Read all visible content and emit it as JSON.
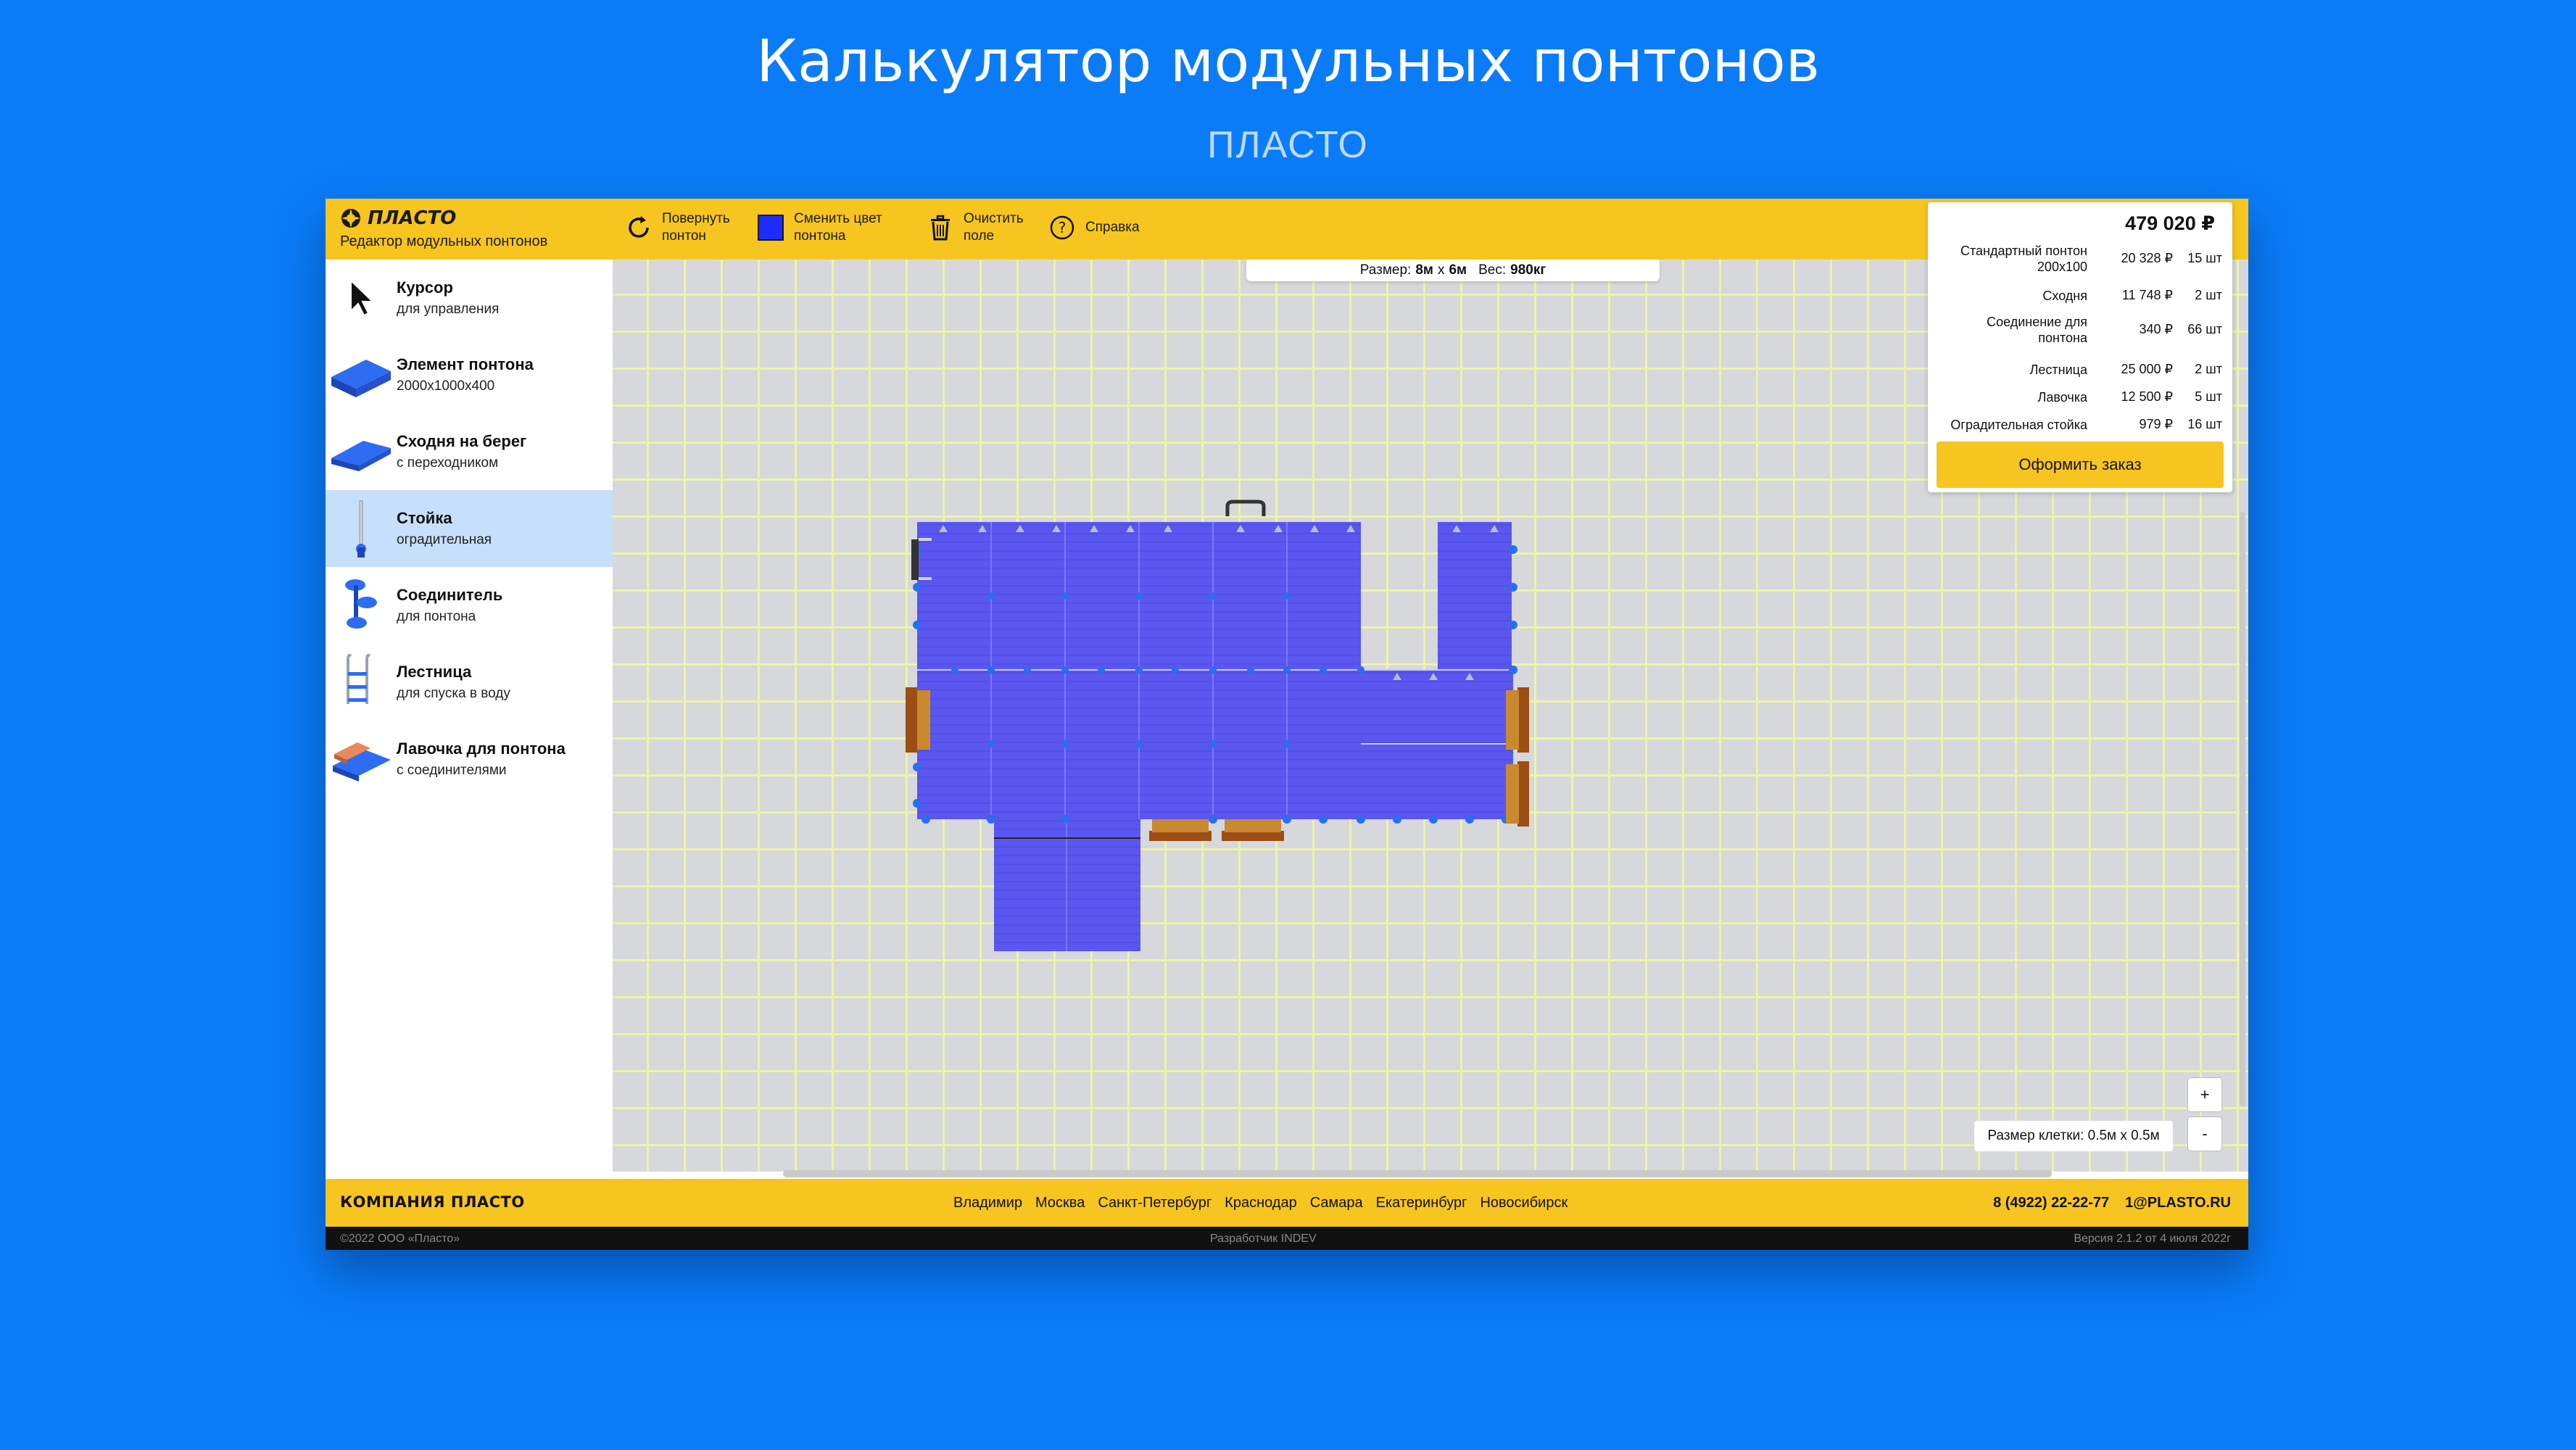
{
  "hero": {
    "title": "Калькулятор модульных понтонов",
    "subtitle": "ПЛАСТО"
  },
  "app": {
    "brand": {
      "logo_text": "ПЛАСТО",
      "tagline": "Редактор модульных понтонов"
    },
    "toolbar": [
      {
        "icon": "rotate-icon",
        "label_line1": "Повернуть",
        "label_line2": "понтон"
      },
      {
        "icon": "color-swatch-icon",
        "label_line1": "Сменить цвет",
        "label_line2": "понтона",
        "color": "#1e2dff"
      },
      {
        "icon": "trash-icon",
        "label_line1": "Очистить",
        "label_line2": "поле"
      },
      {
        "icon": "help-icon",
        "label_line1": "Справка",
        "label_line2": ""
      }
    ],
    "sidebar": {
      "active_index": 3,
      "items": [
        {
          "icon": "cursor-icon",
          "title": "Курсор",
          "subtitle": "для управления"
        },
        {
          "icon": "pontoon-element-icon",
          "title": "Элемент понтона",
          "subtitle": "2000x1000x400"
        },
        {
          "icon": "gangway-icon",
          "title": "Сходня на берег",
          "subtitle": "с переходником"
        },
        {
          "icon": "post-icon",
          "title": "Стойка",
          "subtitle": "оградительная"
        },
        {
          "icon": "connector-icon",
          "title": "Соединитель",
          "subtitle": "для понтона"
        },
        {
          "icon": "ladder-icon",
          "title": "Лестница",
          "subtitle": "для спуска в воду"
        },
        {
          "icon": "bench-icon",
          "title": "Лавочка для понтона",
          "subtitle": "с соединителями"
        }
      ]
    },
    "size_bar": {
      "size_label": "Размер:",
      "size_value": "8м",
      "size_sep": "x",
      "size_value2": "6м",
      "weight_label": "Вес:",
      "weight_value": "980кг"
    },
    "order": {
      "total": "479 020 ₽",
      "rows": [
        {
          "name": "Стандартный понтон 200x100",
          "price": "20 328 ₽",
          "qty": "15 шт"
        },
        {
          "name": "Сходня",
          "price": "11 748 ₽",
          "qty": "2 шт"
        },
        {
          "name": "Соединение для понтона",
          "price": "340 ₽",
          "qty": "66 шт"
        },
        {
          "name": "Лестница",
          "price": "25 000 ₽",
          "qty": "2 шт"
        },
        {
          "name": "Лавочка",
          "price": "12 500 ₽",
          "qty": "5 шт"
        },
        {
          "name": "Оградительная стойка",
          "price": "979 ₽",
          "qty": "16 шт"
        }
      ],
      "button": "Оформить заказ"
    },
    "zoom": {
      "plus": "+",
      "minus": "-"
    },
    "cell_size": "Размер клетки: 0.5м x 0.5м",
    "colors": {
      "accent": "#f7c520",
      "pontoon": "#5a56ef",
      "background": "#0a7cf7",
      "grid": "#eef3a6"
    },
    "footer": {
      "brand": "КОМПАНИЯ ПЛАСТО",
      "cities": [
        "Владимир",
        "Москва",
        "Санкт-Петербург",
        "Краснодар",
        "Самара",
        "Екатеринбург",
        "Новосибирск"
      ],
      "phone": "8 (4922) 22-22-77",
      "email": "1@PLASTO.RU",
      "copyright": "©2022 ООО «Пласто»",
      "developer": "Разработчик INDEV",
      "version": "Версия 2.1.2 от 4 июля 2022г"
    }
  }
}
